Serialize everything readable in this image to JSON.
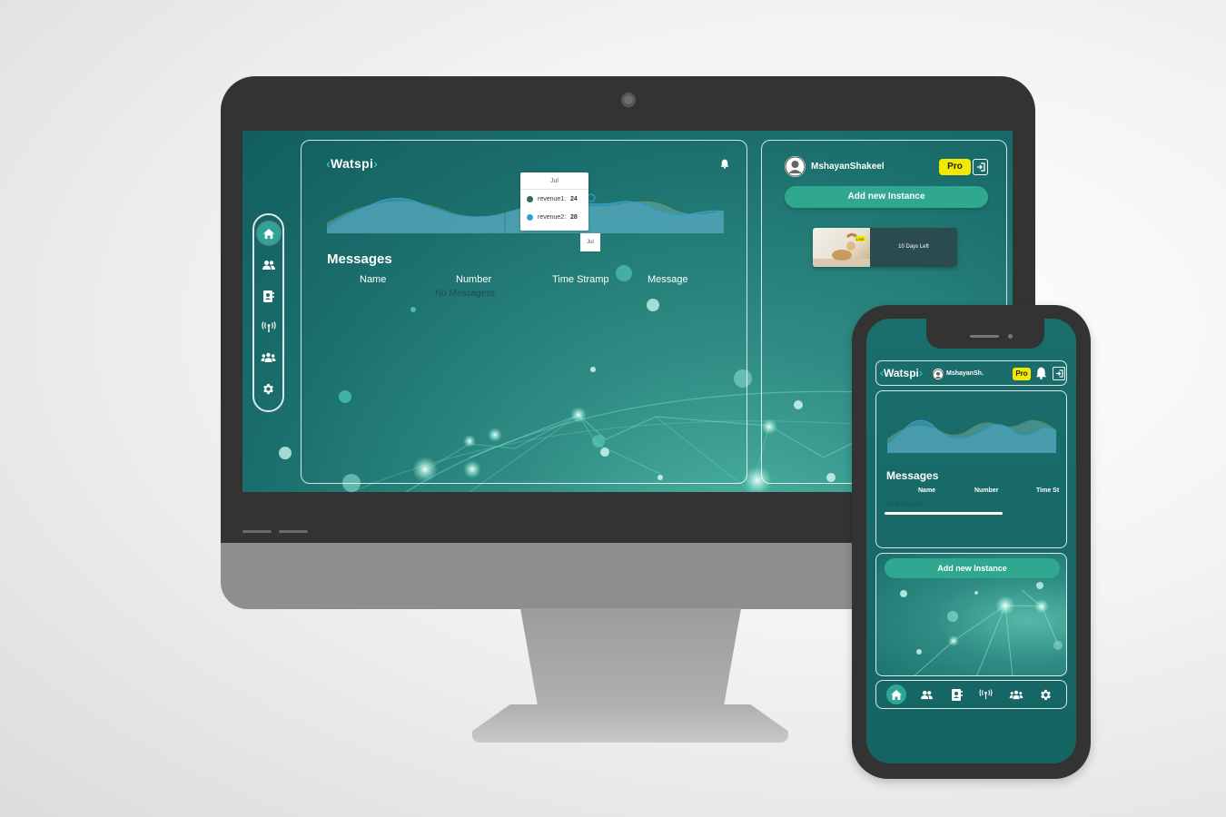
{
  "brand": {
    "logo_text": "Watspi",
    "accent_color": "#3ae0d3",
    "primary_color": "#1a6e6c",
    "button_color": "#30a890",
    "pro_color": "#f3e800"
  },
  "desktop": {
    "sidebar": {
      "items": [
        {
          "icon": "home-icon",
          "active": true
        },
        {
          "icon": "users-icon"
        },
        {
          "icon": "contacts-icon"
        },
        {
          "icon": "antenna-icon"
        },
        {
          "icon": "group-icon"
        },
        {
          "icon": "settings-icon"
        }
      ]
    },
    "header": {
      "bell_icon": "bell-icon"
    },
    "chart": {
      "tooltip": {
        "title": "Jul",
        "rows": [
          {
            "label": "revenue1:",
            "value": "24",
            "color": "#2f6e4a"
          },
          {
            "label": "revenue2:",
            "value": "28",
            "color": "#2ea0d8"
          }
        ]
      },
      "x_tag": "Jul"
    },
    "messages": {
      "title": "Messages",
      "columns": [
        "Name",
        "Number",
        "Time Stramp",
        "Message"
      ],
      "empty_text": "No Messagess"
    },
    "user": {
      "name": "MshayanShakeel",
      "plan": "Pro"
    },
    "add_instance_label": "Add new Instance",
    "instance": {
      "status_text": "10 Days Left",
      "badge": "LIVE"
    }
  },
  "mobile": {
    "logo_text": "Watspi",
    "user_name": "MshayanSh.",
    "plan": "Pro",
    "messages": {
      "title": "Messages",
      "columns": [
        "Name",
        "Number",
        "Time St"
      ],
      "empty_text": "No Messagess"
    },
    "add_instance_label": "Add new Instance"
  }
}
